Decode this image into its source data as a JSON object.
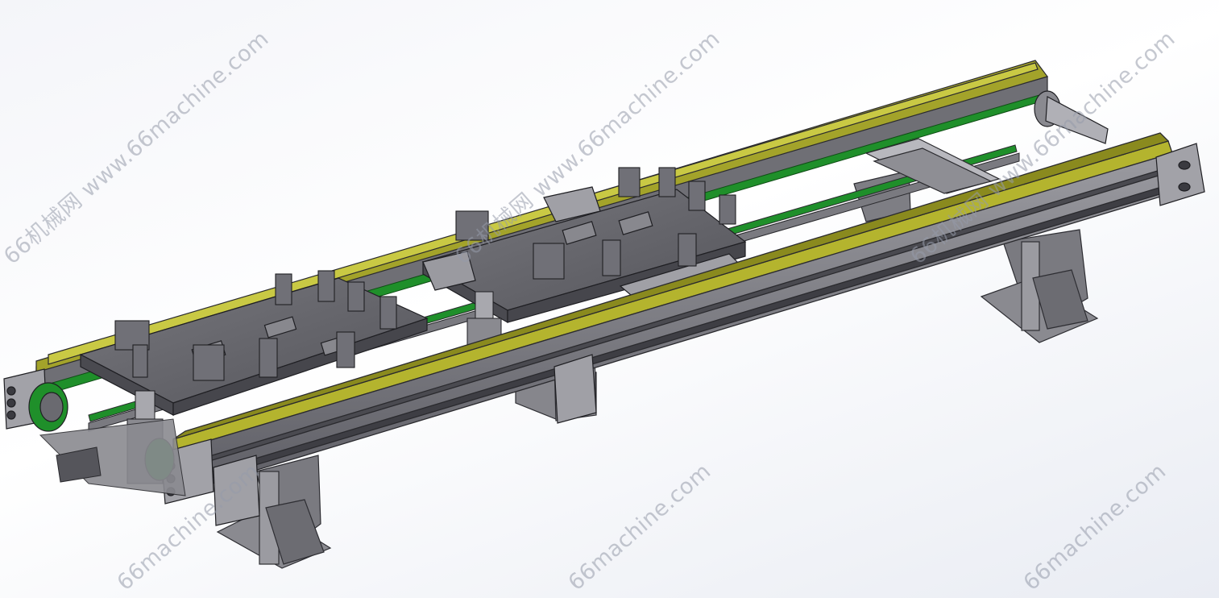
{
  "watermarks": [
    {
      "text": "66机械网 www.66machine.com"
    },
    {
      "text": "66机械网 www.66machine.com"
    },
    {
      "text": "66机械网 www.66machine.com"
    },
    {
      "text": "66machine.com"
    },
    {
      "text": "66machine.com"
    },
    {
      "text": "66machine.com"
    }
  ],
  "colors": {
    "rail_yellow": "#9a9a22",
    "belt_green": "#1f8f2a",
    "metal_gray": "#6e6e74",
    "plate_gray": "#5c5c62"
  }
}
